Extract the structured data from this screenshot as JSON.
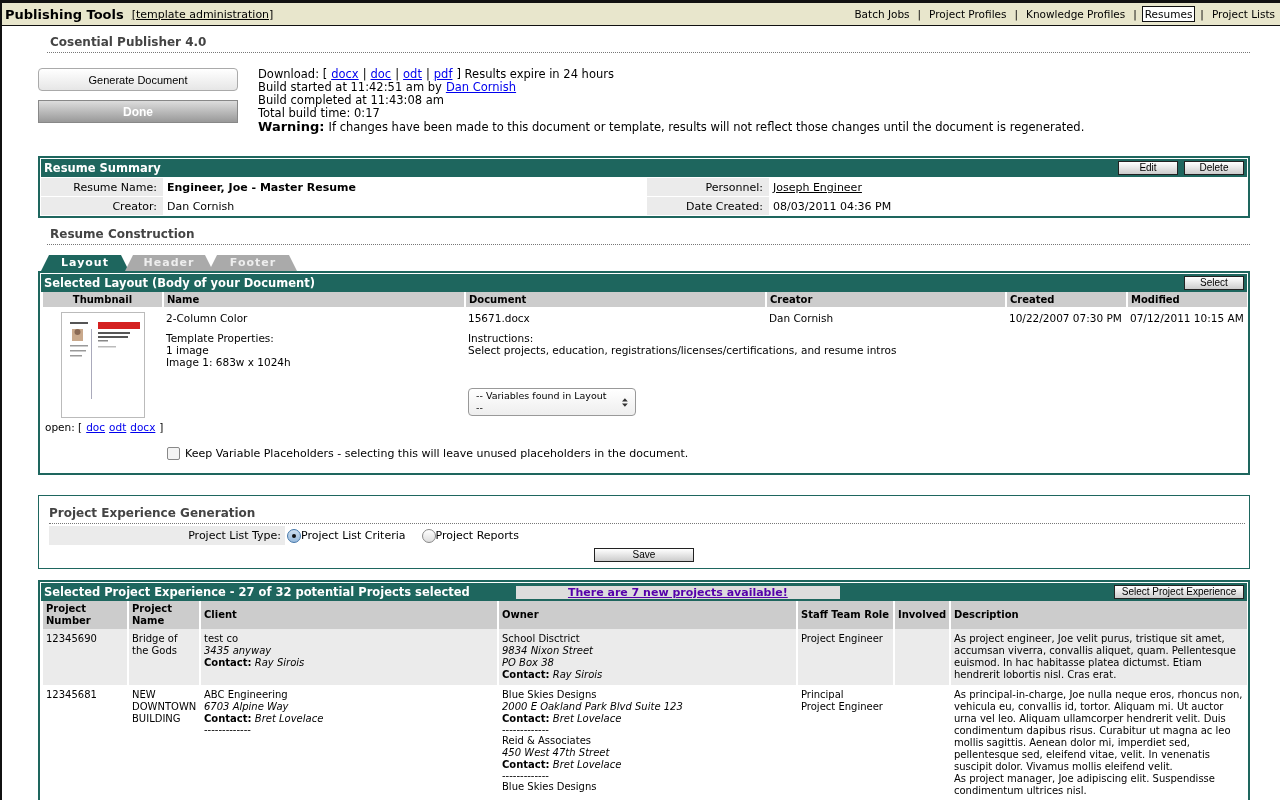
{
  "app_bar": {
    "title": "Publishing Tools",
    "admin_link": "[template administration]",
    "separator": "|",
    "nav": [
      {
        "label": "Batch Jobs",
        "selected": false
      },
      {
        "label": "Project Profiles",
        "selected": false
      },
      {
        "label": "Knowledge Profiles",
        "selected": false
      },
      {
        "label": "Resumes",
        "selected": true
      },
      {
        "label": "Project Lists",
        "selected": false
      }
    ]
  },
  "product_title": "Cosential Publisher 4.0",
  "generate_button": "Generate Document",
  "done_button": {
    "label": "Done",
    "disabled": true
  },
  "build_info": {
    "download_label": "Download: [",
    "formats": [
      "docx",
      "doc",
      "odt",
      "pdf"
    ],
    "separator": "|",
    "expire_text": "] Results expire in 24 hours",
    "started_text": "Build started at 11:42:51 am by",
    "started_by": "Dan Cornish",
    "completed": "Build completed at 11:43:08 am",
    "total": "Total build time: 0:17",
    "warning_label": "Warning:",
    "warning_text": "If changes have been made to this document or template, results will not reflect those changes until the document is regenerated."
  },
  "resume_summary": {
    "title": "Resume Summary",
    "buttons": [
      "Edit",
      "Delete"
    ],
    "fields": [
      {
        "label": "Resume Name:",
        "value": "Engineer, Joe - Master Resume",
        "kind": "bold"
      },
      {
        "label": "Personnel:",
        "value": "Joseph Engineer",
        "kind": "link"
      },
      {
        "label": "Creator:",
        "value": "Dan Cornish",
        "kind": "text"
      },
      {
        "label": "Date Created:",
        "value": "08/03/2011 04:36 PM",
        "kind": "text"
      }
    ]
  },
  "construction_title": "Resume Construction",
  "tabs": [
    {
      "label": "Layout",
      "selected": true
    },
    {
      "label": "Header",
      "selected": false
    },
    {
      "label": "Footer",
      "selected": false
    }
  ],
  "layout_panel": {
    "title": "Selected Layout (Body of your Document)",
    "select_button": "Select",
    "columns": [
      "Thumbnail",
      "Name",
      "Document",
      "Creator",
      "Created",
      "Modified"
    ],
    "row": {
      "open_label": "open: [",
      "open_links": [
        "doc",
        "odt",
        "docx"
      ],
      "open_close": "]",
      "name": "2-Column Color",
      "properties_label": "Template Properties:",
      "properties": [
        "1 image",
        "Image 1: 683w x 1024h"
      ],
      "document": "15671.docx",
      "instructions_label": "Instructions:",
      "instructions": "Select projects, education, registrations/licenses/certifications, and resume intros",
      "variables_select": "-- Variables found in Layout --",
      "creator": "Dan Cornish",
      "created": "10/22/2007 07:30 PM",
      "modified": "07/12/2011 10:15 AM"
    },
    "keep_placeholders": {
      "label": "Keep Variable Placeholders - selecting this will leave unused placeholders in the document.",
      "checked": false
    }
  },
  "project_generation": {
    "title": "Project Experience Generation",
    "list_type_label": "Project List Type:",
    "options": [
      {
        "label": "Project List Criteria",
        "selected": true
      },
      {
        "label": "Project Reports",
        "selected": false
      }
    ],
    "save_button": "Save"
  },
  "experience": {
    "title": "Selected Project Experience - 27 of 32 potential Projects selected",
    "new_projects_link": "There are 7 new projects available!",
    "select_button": "Select Project Experience",
    "columns": [
      {
        "label": "Project Number"
      },
      {
        "label": "Project Name"
      },
      {
        "label": "Client"
      },
      {
        "label": "Owner"
      },
      {
        "label": "Staff Team Role"
      },
      {
        "label": "Involved"
      },
      {
        "label": "Description"
      }
    ],
    "rows": [
      {
        "number": "12345690",
        "name": "Bridge of the Gods",
        "client": [
          {
            "kind": "plain",
            "text": "test co"
          },
          {
            "kind": "italic",
            "text": "3435 anyway"
          },
          {
            "kind": "contact",
            "label": "Contact:",
            "text": "Ray Sirois"
          }
        ],
        "owner": [
          {
            "kind": "plain",
            "text": "School Disctrict"
          },
          {
            "kind": "italic",
            "text": "9834 Nixon Street"
          },
          {
            "kind": "italic",
            "text": "PO Box 38"
          },
          {
            "kind": "contact",
            "label": "Contact:",
            "text": "Ray Sirois"
          }
        ],
        "role": [
          "Project Engineer"
        ],
        "description": [
          "As project engineer, Joe velit purus, tristique sit amet, accumsan viverra, convallis aliquet, quam. Pellentesque euismod. In hac habitasse platea dictumst. Etiam hendrerit lobortis nisl. Cras erat."
        ]
      },
      {
        "number": "12345681",
        "name": "NEW DOWNTOWN BUILDING",
        "client": [
          {
            "kind": "plain",
            "text": "ABC Engineering"
          },
          {
            "kind": "italic",
            "text": "6703 Alpine Way"
          },
          {
            "kind": "contact",
            "label": "Contact:",
            "text": "Bret Lovelace"
          },
          {
            "kind": "separator",
            "text": "-------------"
          }
        ],
        "owner": [
          {
            "kind": "plain",
            "text": "Blue Skies Designs"
          },
          {
            "kind": "italic",
            "text": "2000 E Oakland Park Blvd Suite 123"
          },
          {
            "kind": "contact",
            "label": "Contact:",
            "text": "Bret Lovelace"
          },
          {
            "kind": "separator",
            "text": "-------------"
          },
          {
            "kind": "plain",
            "text": "Reid & Associates"
          },
          {
            "kind": "italic",
            "text": "450 West 47th Street"
          },
          {
            "kind": "contact",
            "label": "Contact:",
            "text": "Bret Lovelace"
          },
          {
            "kind": "separator",
            "text": "-------------"
          },
          {
            "kind": "plain",
            "text": "Blue Skies Designs"
          }
        ],
        "role": [
          "Principal",
          "Project Engineer"
        ],
        "description": [
          "As principal-in-charge, Joe nulla neque eros, rhoncus non, vehicula eu, convallis id, tortor. Aliquam mi. Ut auctor urna vel leo. Aliquam ullamcorper hendrerit velit. Duis condimentum dapibus risus. Curabitur ut magna ac leo mollis sagittis. Aenean dolor mi, imperdiet sed, pellentesque sed, eleifend vitae, velit. In venenatis suscipit dolor. Vivamus mollis eleifend velit.",
          "As project manager, Joe adipiscing elit. Suspendisse condimentum ultrices nisl."
        ]
      }
    ]
  }
}
